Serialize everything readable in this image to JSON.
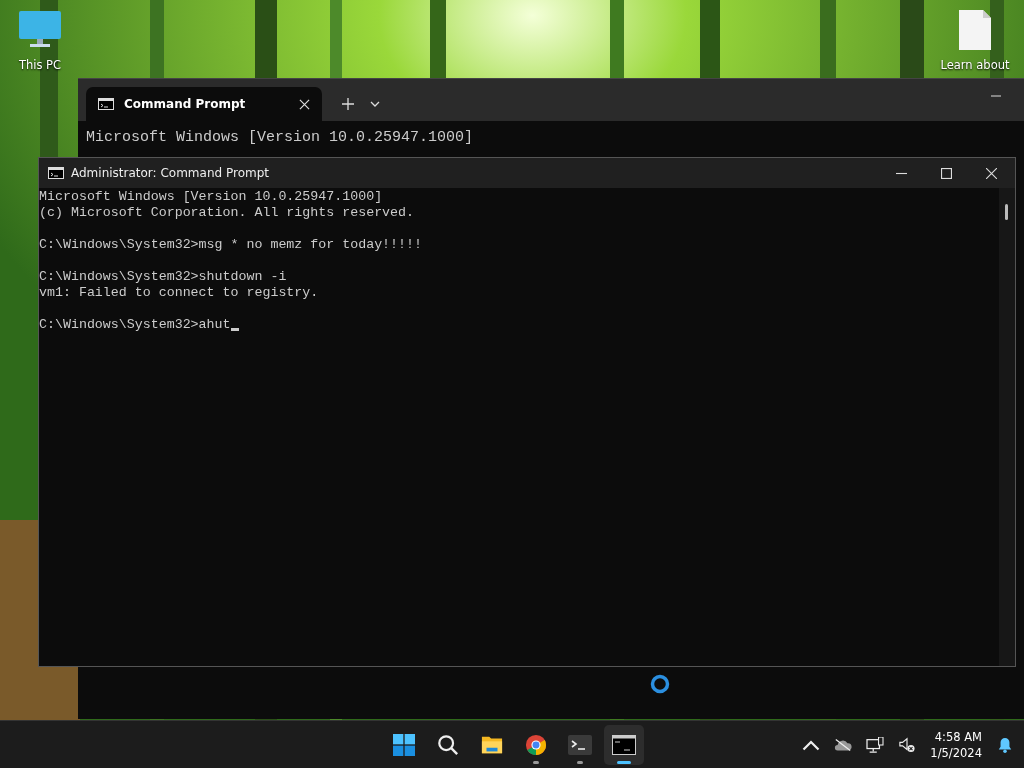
{
  "desktop": {
    "icons": [
      {
        "kind": "computer",
        "label": "This PC"
      },
      {
        "kind": "file",
        "label": "Learn about"
      }
    ]
  },
  "back_window": {
    "tabs": [
      {
        "label": "Command Prompt",
        "selected": true
      }
    ],
    "lines": [
      "Microsoft Windows [Version 10.0.25947.1000]"
    ],
    "busy": true
  },
  "front_window": {
    "title": "Administrator: Command Prompt",
    "blocks": [
      [
        "Microsoft Windows [Version 10.0.25947.1000]",
        "(c) Microsoft Corporation. All rights reserved."
      ],
      [
        "C:\\Windows\\System32>msg * no memz for today!!!!!"
      ],
      [
        "C:\\Windows\\System32>shutdown -i",
        "vm1: Failed to connect to registry."
      ]
    ],
    "input": "C:\\Windows\\System32>ahut"
  },
  "taskbar": {
    "apps": [
      {
        "kind": "start",
        "running": false,
        "selected": false
      },
      {
        "kind": "search",
        "running": false,
        "selected": false
      },
      {
        "kind": "folder",
        "running": false,
        "selected": false
      },
      {
        "kind": "browser",
        "running": true,
        "selected": false
      },
      {
        "kind": "terminal",
        "running": true,
        "selected": false
      },
      {
        "kind": "console",
        "running": true,
        "selected": true
      }
    ],
    "clock": {
      "time": "4:58 AM",
      "date": "1/5/2024"
    }
  }
}
